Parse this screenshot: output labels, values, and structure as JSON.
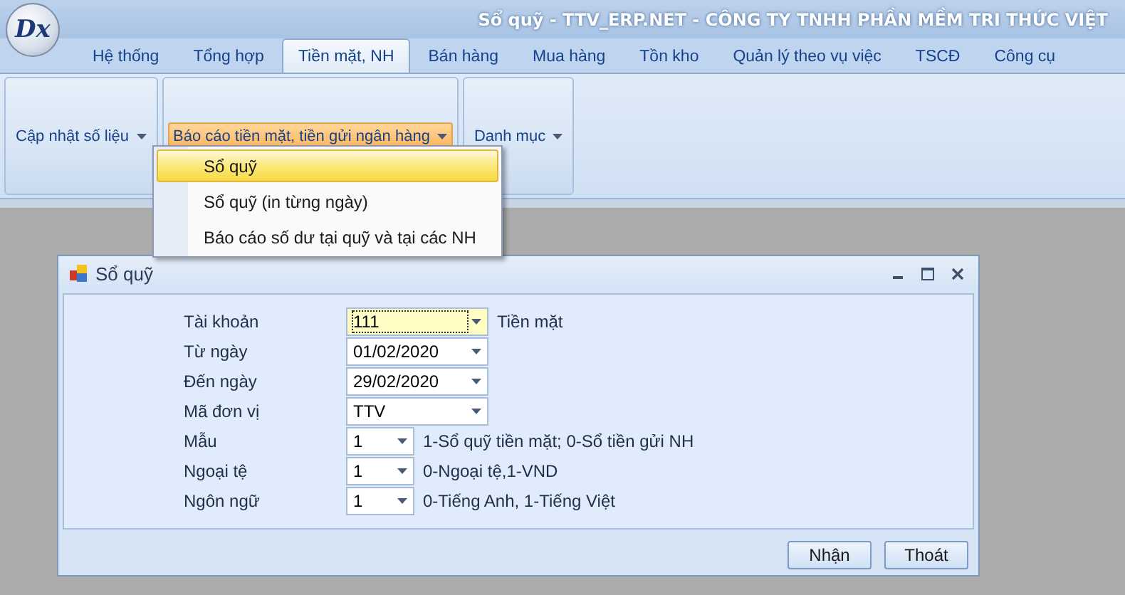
{
  "window": {
    "logo": "Dx",
    "title": "Sổ quỹ - TTV_ERP.NET - CÔNG TY TNHH PHẦN MỀM TRI THỨC VIỆT"
  },
  "tabs": [
    {
      "label": "Hệ thống",
      "selected": false
    },
    {
      "label": "Tổng hợp",
      "selected": false
    },
    {
      "label": "Tiền mặt, NH",
      "selected": true
    },
    {
      "label": "Bán hàng",
      "selected": false
    },
    {
      "label": "Mua hàng",
      "selected": false
    },
    {
      "label": "Tồn kho",
      "selected": false
    },
    {
      "label": "Quản lý theo vụ việc",
      "selected": false
    },
    {
      "label": "TSCĐ",
      "selected": false
    },
    {
      "label": "Công cụ",
      "selected": false
    }
  ],
  "ribbon_groups": [
    {
      "label": "Cập nhật số liệu",
      "expanded": false
    },
    {
      "label": "Báo cáo tiền mặt, tiền gửi ngân hàng",
      "expanded": true
    },
    {
      "label": "Danh mục",
      "expanded": false
    }
  ],
  "menu": {
    "items": [
      {
        "label": "Sổ quỹ",
        "selected": true
      },
      {
        "label": "Sổ quỹ (in từng ngày)",
        "selected": false
      },
      {
        "label": "Báo cáo số dư tại quỹ và tại các NH",
        "selected": false
      }
    ]
  },
  "dialog": {
    "title": "Sổ quỹ",
    "fields": [
      {
        "label": "Tài khoản",
        "kind": "combo",
        "value": "111",
        "focused": true,
        "note": "Tiền mặt"
      },
      {
        "label": "Từ ngày",
        "kind": "combo",
        "value": "01/02/2020",
        "focused": false
      },
      {
        "label": "Đến ngày",
        "kind": "combo",
        "value": "29/02/2020",
        "focused": false
      },
      {
        "label": "Mã đơn vị",
        "kind": "combo",
        "value": "TTV",
        "focused": false
      },
      {
        "label": "Mẫu",
        "kind": "option",
        "value": "1",
        "focused": false,
        "note": "1-Sổ quỹ tiền mặt; 0-Sổ tiền gửi NH"
      },
      {
        "label": "Ngoại tệ",
        "kind": "option",
        "value": "1",
        "focused": false,
        "note": "0-Ngoại tệ,1-VND"
      },
      {
        "label": "Ngôn ngữ",
        "kind": "option",
        "value": "1",
        "focused": false,
        "note": "0-Tiếng Anh, 1-Tiếng Việt"
      }
    ],
    "buttons": [
      "Nhận",
      "Thoát"
    ]
  }
}
